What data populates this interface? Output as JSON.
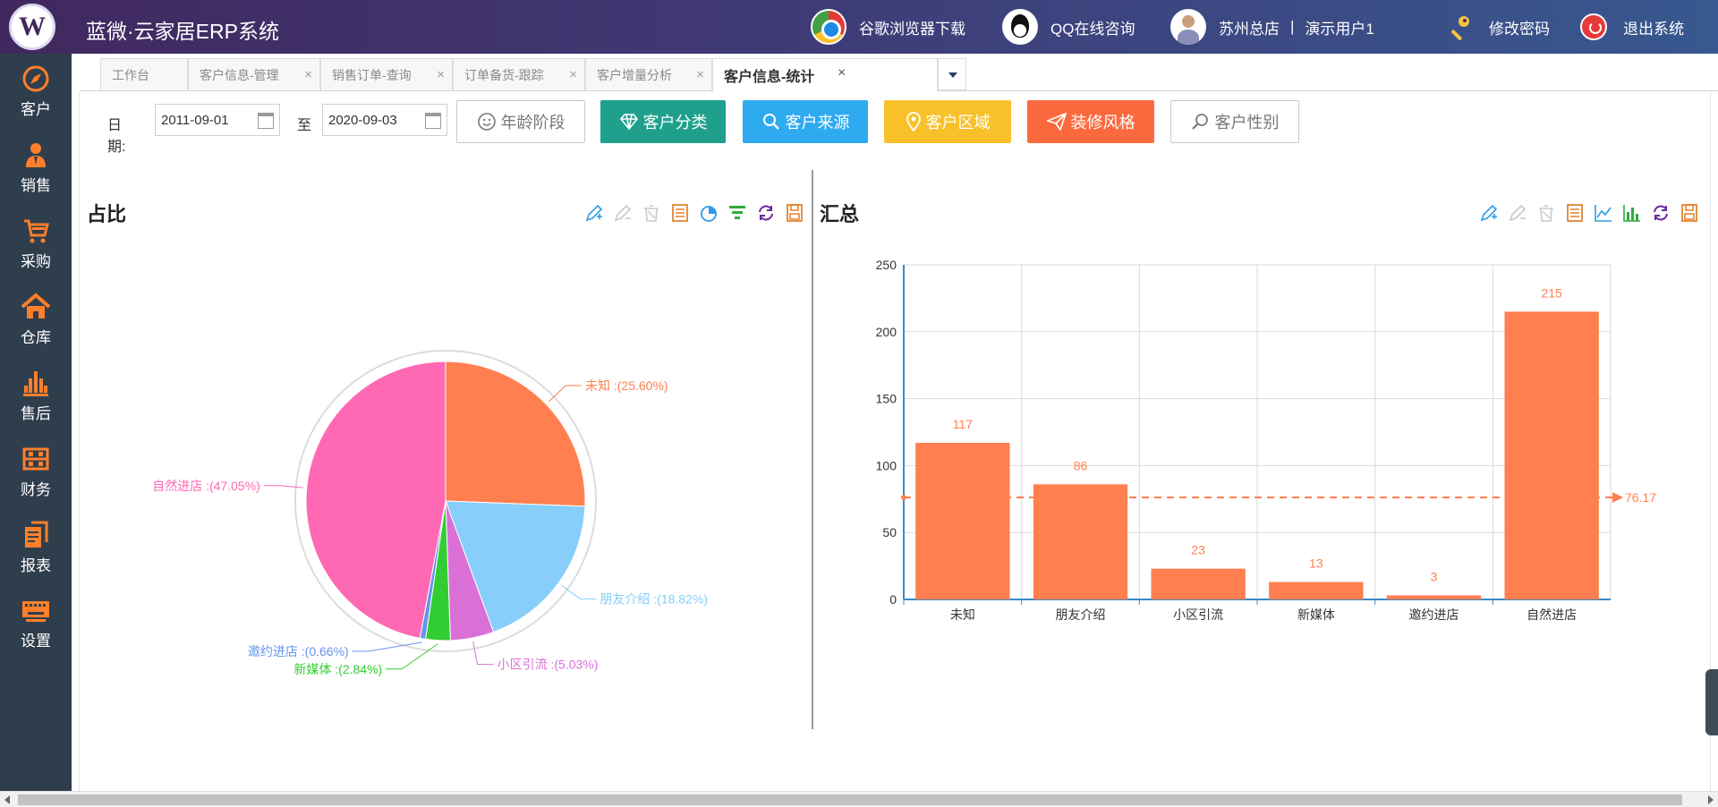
{
  "header": {
    "app_title": "蓝微·云家居ERP系统",
    "chrome_download": "谷歌浏览器下载",
    "qq_consult": "QQ在线咨询",
    "store": "苏州总店",
    "separator": "|",
    "user": "演示用户1",
    "change_password": "修改密码",
    "logout": "退出系统"
  },
  "sidebar": {
    "items": [
      {
        "label": "客户",
        "icon": "compass-icon"
      },
      {
        "label": "销售",
        "icon": "salesperson-icon"
      },
      {
        "label": "采购",
        "icon": "cart-icon"
      },
      {
        "label": "仓库",
        "icon": "home-icon"
      },
      {
        "label": "售后",
        "icon": "service-icon"
      },
      {
        "label": "财务",
        "icon": "abacus-icon"
      },
      {
        "label": "报表",
        "icon": "report-icon"
      },
      {
        "label": "设置",
        "icon": "keyboard-icon"
      }
    ]
  },
  "tabs": [
    {
      "label": "工作台",
      "closable": false
    },
    {
      "label": "客户信息-管理",
      "closable": true
    },
    {
      "label": "销售订单-查询",
      "closable": true
    },
    {
      "label": "订单备货-跟踪",
      "closable": true
    },
    {
      "label": "客户增量分析",
      "closable": true
    },
    {
      "label": "客户信息-统计",
      "closable": true,
      "active": true
    }
  ],
  "tab_close_glyph": "×",
  "filters": {
    "date_label": "日期:",
    "start_date": "2011-09-01",
    "to_label": "至",
    "end_date": "2020-09-03"
  },
  "buttons": [
    {
      "label": "年龄阶段",
      "color": "#ffffff",
      "icon": "smile-icon"
    },
    {
      "label": "客户分类",
      "color": "#1fa08c",
      "icon": "diamond-icon"
    },
    {
      "label": "客户来源",
      "color": "#2eaaf0",
      "icon": "search-icon"
    },
    {
      "label": "客户区域",
      "color": "#f8c12b",
      "icon": "location-icon"
    },
    {
      "label": "装修风格",
      "color": "#fb6a3e",
      "icon": "send-icon"
    },
    {
      "label": "客户性别",
      "color": "#ffffff",
      "icon": "search-icon"
    }
  ],
  "panels": {
    "left_title": "占比",
    "right_title": "汇总"
  },
  "colors": {
    "header_start": "#41285e",
    "header_end": "#38588f",
    "sidebar": "#2f3e4d",
    "bar": "#ff7f50",
    "mean_line": "#ff7f50"
  },
  "chart_data": [
    {
      "type": "pie",
      "categories": [
        "未知",
        "朋友介绍",
        "小区引流",
        "新媒体",
        "邀约进店",
        "自然进店"
      ],
      "values": [
        117,
        86,
        23,
        13,
        3,
        215
      ],
      "labels": [
        "未知 :(25.60%)",
        "朋友介绍 :(18.82%)",
        "小区引流 :(5.03%)",
        "新媒体 :(2.84%)",
        "邀约进店 :(0.66%)",
        "自然进店 :(47.05%)"
      ],
      "percentages": [
        25.6,
        18.82,
        5.03,
        2.84,
        0.66,
        47.05
      ],
      "colors": [
        "#ff7f50",
        "#87cefa",
        "#da70d6",
        "#32cd32",
        "#6495ed",
        "#ff69b4"
      ]
    },
    {
      "type": "bar",
      "categories": [
        "未知",
        "朋友介绍",
        "小区引流",
        "新媒体",
        "邀约进店",
        "自然进店"
      ],
      "values": [
        117,
        86,
        23,
        13,
        3,
        215
      ],
      "ylim": [
        0,
        250
      ],
      "yticks": [
        0,
        50,
        100,
        150,
        200,
        250
      ],
      "mean": 76.17,
      "mean_label": "76.17",
      "grid": true,
      "color": "#ff7f50"
    }
  ]
}
